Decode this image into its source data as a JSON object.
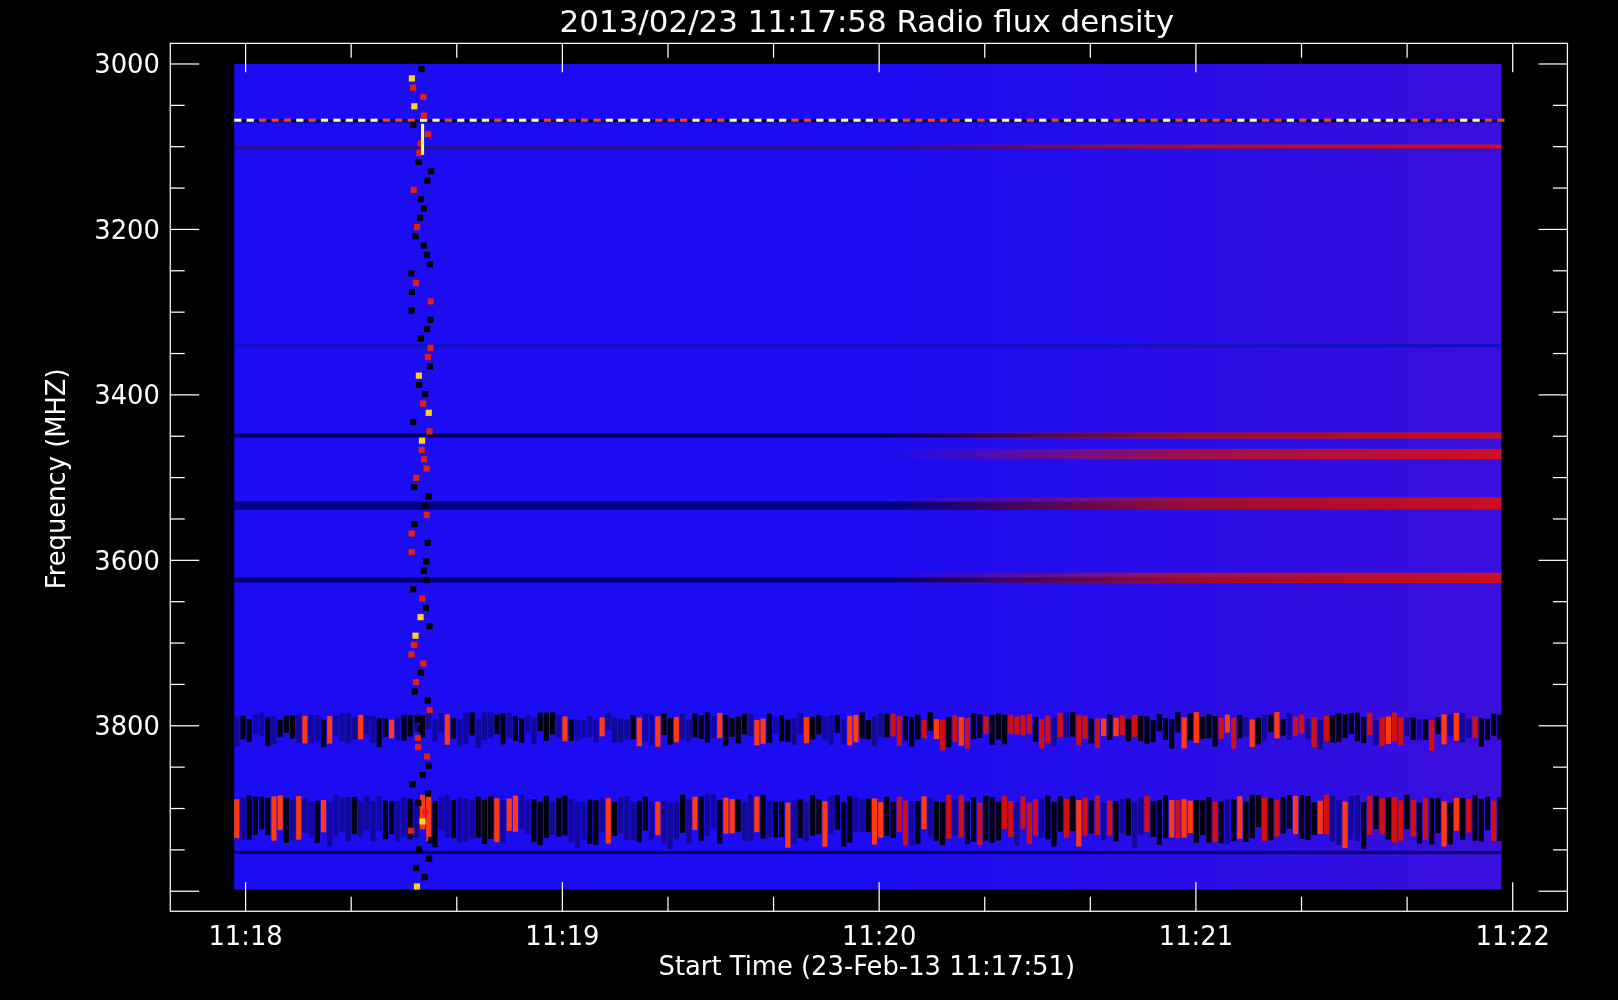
{
  "plot": {
    "title": "2013/02/23 11:17:58 Radio flux density",
    "y_axis": {
      "label": "Frequency (MHZ)",
      "ticks": [
        "3000",
        "3200",
        "3400",
        "3600",
        "3800"
      ]
    },
    "x_axis": {
      "label": "Start Time (23-Feb-13 11:17:51)",
      "ticks": [
        "11:18",
        "11:19",
        "11:20",
        "11:21",
        "11:22"
      ]
    }
  }
}
